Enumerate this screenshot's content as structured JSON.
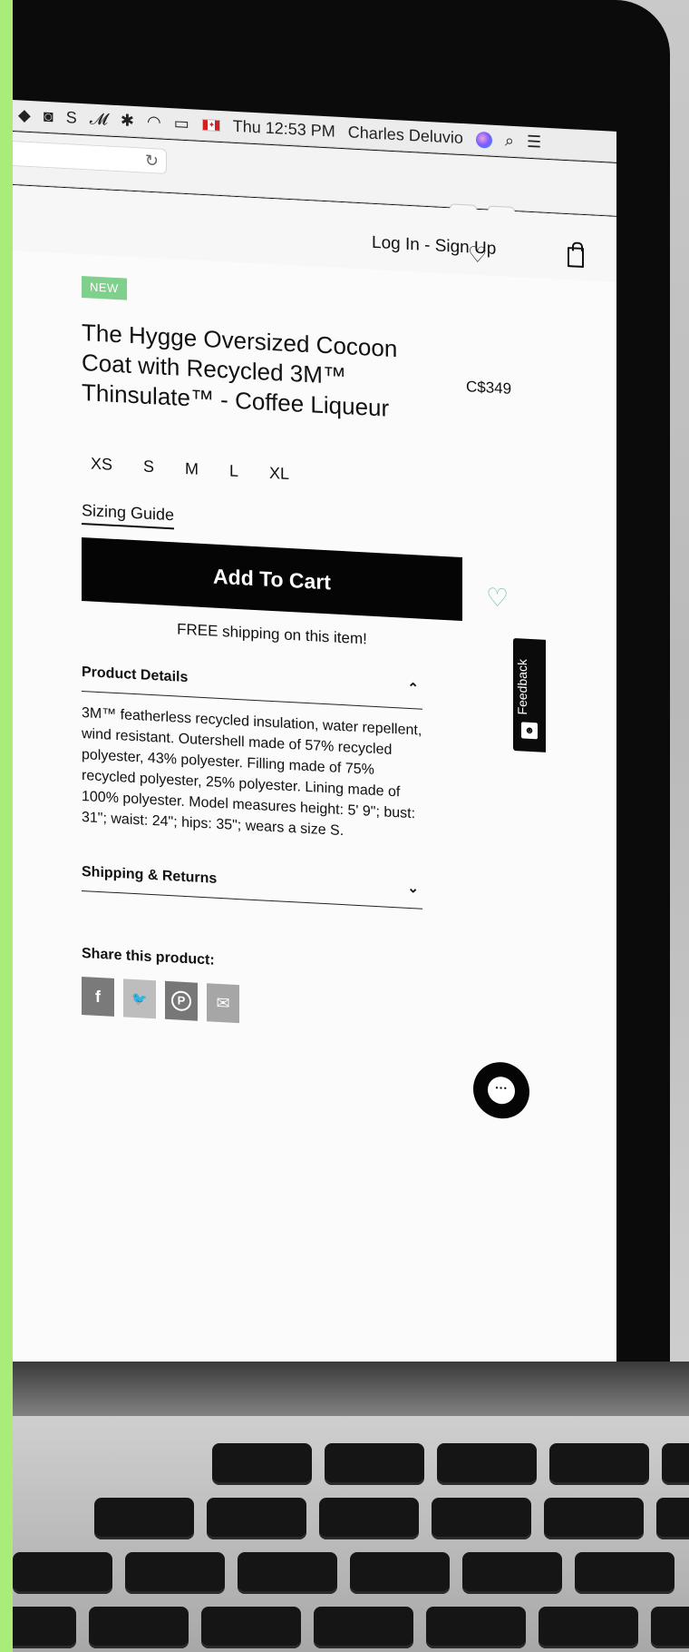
{
  "menubar": {
    "clock": "Thu 12:53 PM",
    "user": "Charles Deluvio",
    "icons": [
      "dropbox-icon",
      "camera-icon",
      "skype-icon",
      "app-m-icon",
      "bluetooth-icon",
      "wifi-icon",
      "battery-icon",
      "flag-icon",
      "siri-icon",
      "spotlight-icon",
      "list-icon"
    ]
  },
  "browser": {
    "reload_glyph": "↻",
    "share_glyph": "⇧",
    "tabs_glyph": "❐",
    "newtab_glyph": "+"
  },
  "header": {
    "login": "Log In - Sign Up",
    "wishlist_glyph": "♡"
  },
  "product": {
    "badge": "NEW",
    "title": "The Hygge Oversized Cocoon Coat with Recycled 3M™ Thinsulate™ - Coffee Liqueur",
    "price": "C$349",
    "sizes": [
      "XS",
      "S",
      "M",
      "L",
      "XL"
    ],
    "sizing_guide": "Sizing Guide",
    "add_to_cart": "Add To Cart",
    "wishlist_glyph": "♡",
    "shipping_note": "FREE shipping on this item!"
  },
  "accordion": {
    "details_label": "Product Details",
    "details_chevron": "⌃",
    "details_text": "3M™ featherless recycled insulation, water repellent, wind resistant. Outershell made of 57% recycled polyester, 43% polyester. Filling made of 75% recycled polyester, 25% polyester. Lining made of 100% polyester. Model measures height: 5' 9\"; bust: 31\"; waist: 24\"; hips: 35\"; wears a size S.",
    "shipping_label": "Shipping & Returns",
    "shipping_chevron": "⌄"
  },
  "share": {
    "label": "Share this product:",
    "facebook": "f",
    "twitter": "🐦",
    "pinterest": "P",
    "email": "✉"
  },
  "feedback": {
    "label": "Feedback"
  },
  "chat": {
    "glyph": "···"
  }
}
